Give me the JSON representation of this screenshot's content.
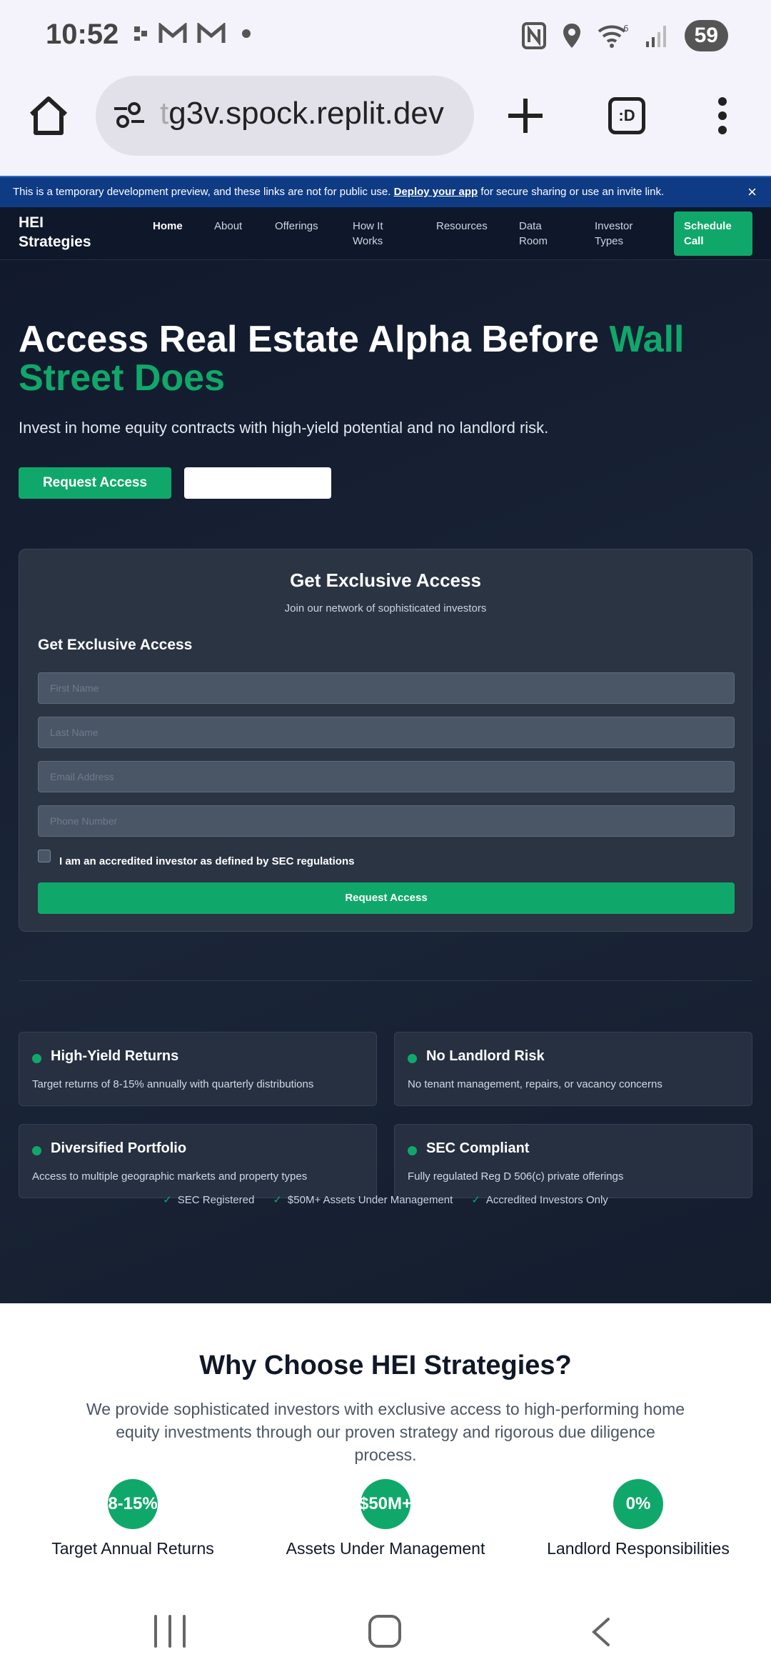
{
  "status_bar": {
    "time": "10:52",
    "battery": "59",
    "icons": [
      "notification-icon",
      "gmail-icon",
      "gmail-icon",
      "dot-icon",
      "nfc-icon",
      "location-icon",
      "wifi-icon",
      "signal-icon"
    ]
  },
  "browser": {
    "url_faded": "t",
    "url_main": "g3v.spock.replit.dev",
    "tabs_label": ":D"
  },
  "dev_banner": {
    "text_before": "This is a temporary development preview, and these links are not for public use.",
    "link": "Deploy your app",
    "text_after": "for secure sharing or use an invite link.",
    "close": "×"
  },
  "nav": {
    "brand": "HEI Strategies",
    "links": [
      "Home",
      "About",
      "Offerings",
      "How It Works",
      "Resources",
      "Data Room",
      "Investor Types"
    ],
    "cta": "Schedule Call"
  },
  "hero": {
    "title_main": "Access Real Estate Alpha Before ",
    "title_accent": "Wall Street Does",
    "subtitle": "Invest in home equity contracts with high-yield potential and no landlord risk.",
    "primary_button": "Request Access",
    "secondary_button": ""
  },
  "form": {
    "title": "Get Exclusive Access",
    "subtitle": "Join our network of sophisticated investors",
    "heading": "Get Exclusive Access",
    "placeholders": {
      "first_name": "First Name",
      "last_name": "Last Name",
      "email": "Email Address",
      "phone": "Phone Number"
    },
    "checkbox_label": "I am an accredited investor as defined by SEC regulations",
    "submit": "Request Access"
  },
  "features": [
    {
      "title": "High-Yield Returns",
      "desc": "Target returns of 8-15% annually with quarterly distributions"
    },
    {
      "title": "No Landlord Risk",
      "desc": "No tenant management, repairs, or vacancy concerns"
    },
    {
      "title": "Diversified Portfolio",
      "desc": "Access to multiple geographic markets and property types"
    },
    {
      "title": "SEC Compliant",
      "desc": "Fully regulated Reg D 506(c) private offerings"
    }
  ],
  "trust": {
    "check": "✓",
    "items": [
      "SEC Registered",
      "$50M+ Assets Under Management",
      "Accredited Investors Only"
    ]
  },
  "why": {
    "title": "Why Choose HEI Strategies?",
    "subtitle": "We provide sophisticated investors with exclusive access to high-performing home equity investments through our proven strategy and rigorous due diligence process.",
    "stats": [
      {
        "value": "8-15%",
        "label": "Target Annual Returns"
      },
      {
        "value": "$50M+",
        "label": "Assets Under Management"
      },
      {
        "value": "0%",
        "label": "Landlord Responsibilities"
      }
    ]
  },
  "colors": {
    "accent": "#10a86a",
    "dark_bg": "#0f172a",
    "banner": "#0f3b84"
  }
}
